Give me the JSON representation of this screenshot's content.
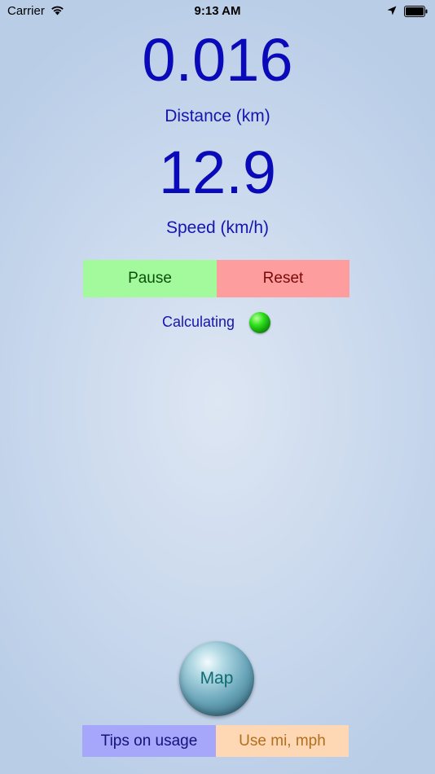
{
  "status_bar": {
    "carrier": "Carrier",
    "time": "9:13 AM",
    "icons": [
      "wifi-icon",
      "location-arrow-icon",
      "battery-icon"
    ]
  },
  "distance": {
    "value": "0.016",
    "label": "Distance (km)"
  },
  "speed": {
    "value": "12.9",
    "label": "Speed (km/h)"
  },
  "controls": {
    "pause_label": "Pause",
    "reset_label": "Reset"
  },
  "calculation": {
    "label": "Calculating",
    "indicator": "green-status-dot"
  },
  "map": {
    "label": "Map"
  },
  "footer": {
    "tips_label": "Tips on usage",
    "units_label": "Use mi, mph"
  },
  "colors": {
    "value_text": "#0a0ab8",
    "pause": "#a2fa9c",
    "reset": "#fd9d9d",
    "tips": "#a6a6fa",
    "units": "#fed7b4",
    "indicator": "#2fe01b"
  }
}
